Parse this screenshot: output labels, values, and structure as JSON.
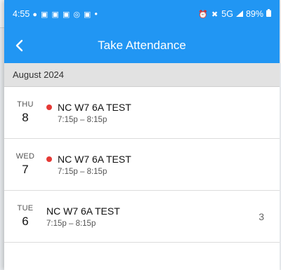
{
  "status_bar": {
    "time": "4:55",
    "left_icons": "● ▣ ▣ ▣ ◎ ▣",
    "bullet": "•",
    "right_icons": "⏰ ✖",
    "network": "5G",
    "battery_percent": "89%"
  },
  "app_bar": {
    "title": "Take Attendance",
    "back_icon": "chevron-left-icon"
  },
  "month_header": "August 2024",
  "sessions": [
    {
      "dow": "THU",
      "day": "8",
      "name": "NC W7 6A TEST",
      "time": "7:15p – 8:15p",
      "flagged": true,
      "count": ""
    },
    {
      "dow": "WED",
      "day": "7",
      "name": "NC W7 6A TEST",
      "time": "7:15p – 8:15p",
      "flagged": true,
      "count": ""
    },
    {
      "dow": "TUE",
      "day": "6",
      "name": "NC W7 6A TEST",
      "time": "7:15p – 8:15p",
      "flagged": false,
      "count": "3"
    }
  ],
  "colors": {
    "primary": "#2196f3",
    "flag_dot": "#e53935",
    "section_bg": "#e2e2e2"
  }
}
